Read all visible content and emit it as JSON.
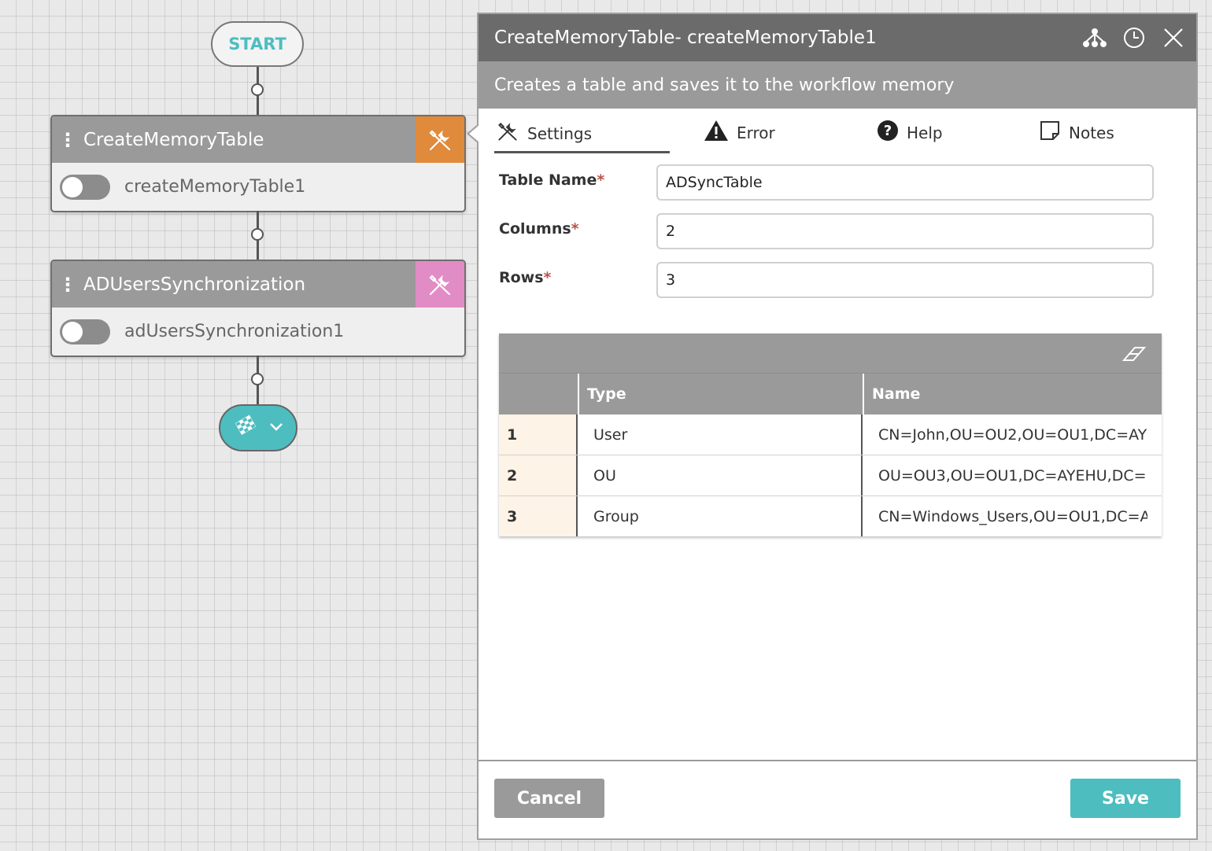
{
  "canvas": {
    "start_label": "START",
    "nodes": [
      {
        "title": "CreateMemoryTable",
        "instance": "createMemoryTable1",
        "accent": "#e08a3c",
        "icon": "tools-icon"
      },
      {
        "title": "ADUsersSynchronization",
        "instance": "adUsersSynchronization1",
        "accent": "#e28cc6",
        "icon": "tools-icon"
      }
    ],
    "end_icon": "checkered-flag-icon"
  },
  "panel": {
    "title": "CreateMemoryTable-  createMemoryTable1",
    "description": "Creates a table and saves it to the workflow memory",
    "header_icons": [
      "hierarchy-icon",
      "clock-icon",
      "close-icon"
    ],
    "tabs": [
      {
        "label": "Settings",
        "icon": "tools-icon",
        "active": true
      },
      {
        "label": "Error",
        "icon": "warning-icon"
      },
      {
        "label": "Help",
        "icon": "question-icon"
      },
      {
        "label": "Notes",
        "icon": "note-icon"
      }
    ],
    "fields": {
      "table_name": {
        "label": "Table Name",
        "value": "ADSyncTable"
      },
      "columns": {
        "label": "Columns",
        "value": "2"
      },
      "rows": {
        "label": "Rows",
        "value": "3"
      },
      "required_marker": "*"
    },
    "grid": {
      "headers": [
        "Type",
        "Name"
      ],
      "rows": [
        {
          "num": "1",
          "type": "User",
          "name": "CN=John,OU=OU2,OU=OU1,DC=AY"
        },
        {
          "num": "2",
          "type": "OU",
          "name": "OU=OU3,OU=OU1,DC=AYEHU,DC=("
        },
        {
          "num": "3",
          "type": "Group",
          "name": "CN=Windows_Users,OU=OU1,DC=A"
        }
      ]
    },
    "buttons": {
      "cancel": "Cancel",
      "save": "Save"
    }
  },
  "colors": {
    "accent_teal": "#4dbdc0",
    "header_dark": "#6b6b6b",
    "header_light": "#9a9a9a"
  }
}
